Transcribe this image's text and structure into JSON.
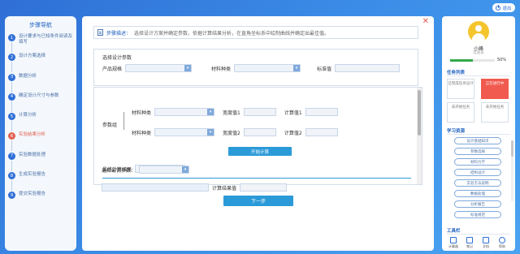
{
  "header": {
    "logout_label": "退出"
  },
  "steps": {
    "title": "步骤导航",
    "items": [
      {
        "num": "1",
        "label": "设计要求与已知条件阅读及填写"
      },
      {
        "num": "2",
        "label": "设计方案选择"
      },
      {
        "num": "3",
        "label": "数据分析"
      },
      {
        "num": "4",
        "label": "确定设计尺寸与参数"
      },
      {
        "num": "5",
        "label": "计算分析"
      },
      {
        "num": "6",
        "label": "实验结果分析"
      },
      {
        "num": "7",
        "label": "实验数据处理"
      },
      {
        "num": "8",
        "label": "生成实验报告"
      },
      {
        "num": "9",
        "label": "提交实验报告"
      }
    ]
  },
  "main": {
    "desc_label": "步骤描述：",
    "desc_text": "选择设计方案并确定参数，依据计算结果分析，在直角坐标系中绘制曲线并确定出最佳值。",
    "box1_title": "选择设计参数",
    "field1_label": "产品规格",
    "field2_label": "材料种类",
    "field3_label": "标准值",
    "fields_left_label": "参数组",
    "row1": {
      "a": "材料种类",
      "b": "宽度值1",
      "c": "计算值1"
    },
    "row2": {
      "a": "材料种类",
      "b": "宽度值2",
      "c": "计算值2"
    },
    "calc_label": "开始计算",
    "result_label": "最终计算结果",
    "result2_label": "选择最优参数：",
    "result3_label": "计算结果值",
    "next_label": "下一步"
  },
  "user": {
    "name": "小峰",
    "role": "实验员",
    "progress_pct": 50,
    "progress_label": "50%"
  },
  "right": {
    "section_tasks": "任务列表",
    "cards": [
      {
        "label": "已完成任务设计",
        "active": false
      },
      {
        "label": "正在进行中",
        "active": true
      },
      {
        "label": "未开始任务",
        "active": false
      },
      {
        "label": "未开始任务",
        "active": false
      }
    ],
    "section_links": "学习资源",
    "links": [
      "设计基础知识",
      "参数选择",
      "材料力学",
      "结构设计",
      "实验方法说明",
      "数据处理",
      "分析报告",
      "标准规范"
    ],
    "section_tools": "工具栏",
    "tools": [
      "计算器",
      "笔记",
      "文档",
      "帮助"
    ]
  }
}
